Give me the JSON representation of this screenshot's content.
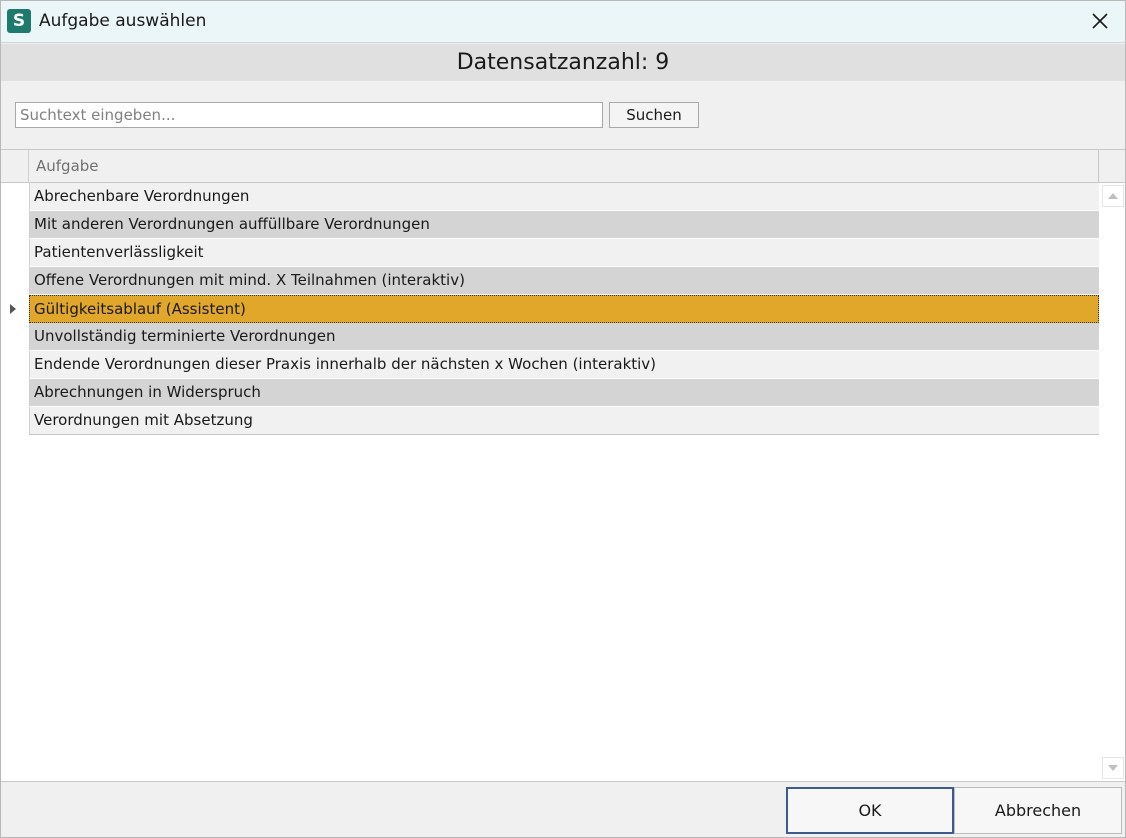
{
  "window": {
    "app_icon_letter": "S",
    "title": "Aufgabe auswählen"
  },
  "header": {
    "record_count": "Datensatzanzahl: 9"
  },
  "search": {
    "placeholder": "Suchtext eingeben...",
    "value": "",
    "button_label": "Suchen"
  },
  "grid": {
    "column_header": "Aufgabe",
    "rows": [
      "Abrechenbare Verordnungen",
      "Mit anderen Verordnungen auffüllbare Verordnungen",
      "Patientenverlässligkeit",
      "Offene Verordnungen mit mind. X Teilnahmen (interaktiv)",
      "Gültigkeitsablauf (Assistent)",
      "Unvollständig terminierte Verordnungen",
      "Endende Verordnungen dieser Praxis innerhalb der nächsten x Wochen (interaktiv)",
      "Abrechnungen in Widerspruch",
      "Verordnungen mit Absetzung"
    ],
    "selected_index": 4
  },
  "footer": {
    "ok_label": "OK",
    "cancel_label": "Abbrechen"
  },
  "colors": {
    "app_icon": "#1f7a6e",
    "titlebar": "#eaf6f7",
    "selected_row": "#e1a72a",
    "row_alt": "#d4d4d4",
    "row": "#f1f1f1"
  },
  "icons": {
    "close": "close-icon",
    "row_indicator": "row-indicator-arrow-icon",
    "scroll_up": "scroll-up-icon",
    "scroll_down": "scroll-down-icon"
  }
}
